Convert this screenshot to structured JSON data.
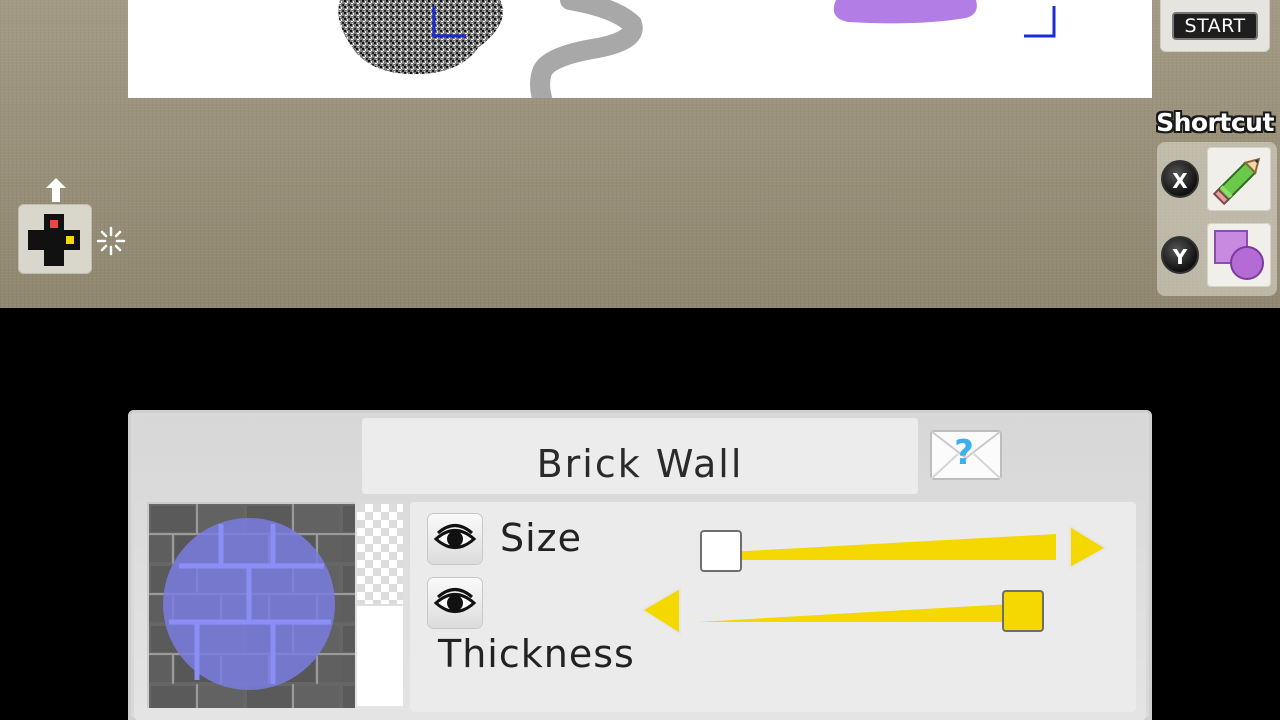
{
  "top_screen": {
    "start_button_label": "START",
    "shortcut": {
      "title": "Shortcut",
      "items": [
        {
          "key": "X",
          "tool": "pencil-icon"
        },
        {
          "key": "Y",
          "tool": "shapes-icon"
        }
      ]
    }
  },
  "tool_panel": {
    "tool_name": "Brick Wall",
    "help_icon": "help-envelope-icon",
    "sliders": [
      {
        "label": "Size",
        "value_fraction": 0.0
      },
      {
        "label": "Thickness",
        "value_fraction": 1.0
      }
    ]
  },
  "colors": {
    "accent_yellow": "#f4d800",
    "canvas_bg": "#ffffff",
    "brush_purple": "#b27ee6",
    "brick_overlay": "#7a7de0"
  }
}
